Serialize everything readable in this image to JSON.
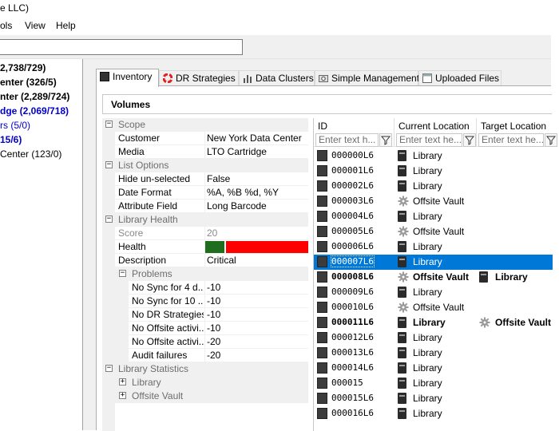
{
  "window": {
    "title_fragment": "e LLC)"
  },
  "menu": {
    "items": [
      "ols",
      "View",
      "Help"
    ]
  },
  "toolbar": {
    "search_value": ""
  },
  "tree": {
    "items": [
      {
        "label": "2,738/729)",
        "color": "#000000",
        "bold": true
      },
      {
        "label": "enter (326/5)",
        "color": "#000000",
        "bold": true
      },
      {
        "label": "nter (2,289/724)",
        "color": "#000000",
        "bold": true
      },
      {
        "label": "dge (2,069/718)",
        "color": "#0000cc",
        "bold": true
      },
      {
        "label": "rs (5/0)",
        "color": "#0000cc",
        "bold": false
      },
      {
        "label": "15/6)",
        "color": "#0000cc",
        "bold": true
      },
      {
        "label": "Center (123/0)",
        "color": "#000000",
        "bold": false
      }
    ]
  },
  "tabs": [
    {
      "label": "Inventory",
      "icon": "tape-icon",
      "active": true
    },
    {
      "label": "DR Strategies",
      "icon": "lifebuoy-icon",
      "active": false
    },
    {
      "label": "Data Clusters",
      "icon": "chart-icon",
      "active": false
    },
    {
      "label": "Simple Management",
      "icon": "camera-icon",
      "active": false
    },
    {
      "label": "Uploaded Files",
      "icon": "window-icon",
      "active": false
    }
  ],
  "volumes": {
    "header": "Volumes"
  },
  "properties": {
    "scope": {
      "title": "Scope",
      "customer_label": "Customer",
      "customer_value": "New York Data Center",
      "media_label": "Media",
      "media_value": "LTO Cartridge"
    },
    "list_options": {
      "title": "List Options",
      "hide_label": "Hide un-selected",
      "hide_value": "False",
      "date_label": "Date Format",
      "date_value": "%A, %B %d, %Y",
      "attr_label": "Attribute Field",
      "attr_value": "Long Barcode"
    },
    "library_health": {
      "title": "Library Health",
      "score_label": "Score",
      "score_value": "20",
      "health_label": "Health",
      "health_good_fraction": 0.2,
      "desc_label": "Description",
      "desc_value": "Critical"
    },
    "problems": {
      "title": "Problems",
      "items": [
        {
          "label": "No Sync for 4 d...",
          "value": "-10"
        },
        {
          "label": "No Sync for 10 ...",
          "value": "-10"
        },
        {
          "label": "No DR Strategies",
          "value": "-10"
        },
        {
          "label": "No Offsite activi...",
          "value": "-10"
        },
        {
          "label": "No Offsite activi...",
          "value": "-20"
        },
        {
          "label": "Audit failures",
          "value": "-20"
        }
      ]
    },
    "library_statistics": {
      "title": "Library Statistics",
      "library_label": "Library",
      "offsite_label": "Offsite Vault"
    }
  },
  "grid": {
    "columns": [
      {
        "label": "ID",
        "filter_placeholder": "Enter text h..."
      },
      {
        "label": "Current Location",
        "filter_placeholder": "Enter text he..."
      },
      {
        "label": "Target Location",
        "filter_placeholder": "Enter text he..."
      }
    ],
    "rows": [
      {
        "id": "000000L6",
        "current": "Library",
        "target": "",
        "bold": false
      },
      {
        "id": "000001L6",
        "current": "Library",
        "target": "",
        "bold": false
      },
      {
        "id": "000002L6",
        "current": "Library",
        "target": "",
        "bold": false
      },
      {
        "id": "000003L6",
        "current": "Offsite Vault",
        "target": "",
        "bold": false
      },
      {
        "id": "000004L6",
        "current": "Library",
        "target": "",
        "bold": false
      },
      {
        "id": "000005L6",
        "current": "Offsite Vault",
        "target": "",
        "bold": false
      },
      {
        "id": "000006L6",
        "current": "Library",
        "target": "",
        "bold": false
      },
      {
        "id": "000007L6",
        "current": "Library",
        "target": "",
        "bold": false,
        "selected": true
      },
      {
        "id": "000008L6",
        "current": "Offsite Vault",
        "target": "Library",
        "bold": true
      },
      {
        "id": "000009L6",
        "current": "Library",
        "target": "",
        "bold": false
      },
      {
        "id": "000010L6",
        "current": "Offsite Vault",
        "target": "",
        "bold": false
      },
      {
        "id": "000011L6",
        "current": "Library",
        "target": "Offsite Vault",
        "bold": true
      },
      {
        "id": "000012L6",
        "current": "Library",
        "target": "",
        "bold": false
      },
      {
        "id": "000013L6",
        "current": "Library",
        "target": "",
        "bold": false
      },
      {
        "id": "000014L6",
        "current": "Library",
        "target": "",
        "bold": false
      },
      {
        "id": "000015",
        "current": "Library",
        "target": "",
        "bold": false
      },
      {
        "id": "000015L6",
        "current": "Library",
        "target": "",
        "bold": false
      },
      {
        "id": "000016L6",
        "current": "Library",
        "target": "",
        "bold": false
      }
    ]
  },
  "colors": {
    "selection": "#0078d7",
    "health_good": "#1e6e1e",
    "health_bad": "#ff0000",
    "category_bg": "#f0f0f0"
  }
}
